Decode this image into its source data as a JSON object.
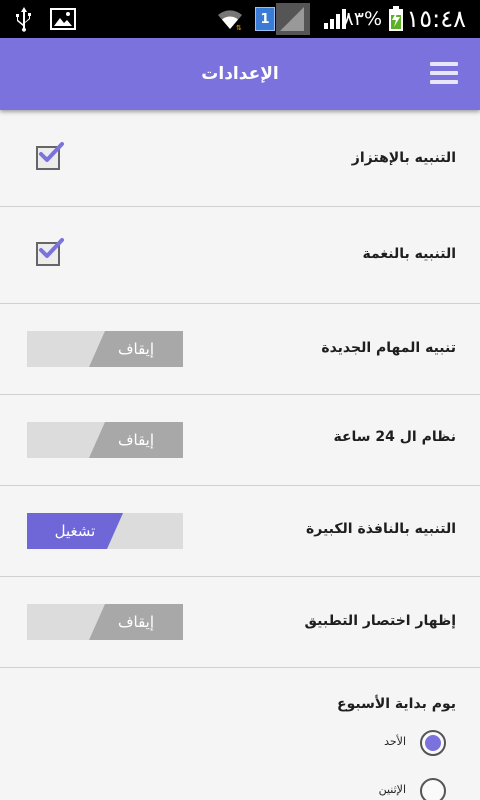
{
  "status_bar": {
    "time": "١٥:٤٨",
    "battery_percent": "٨٣%",
    "sim_badge": "1",
    "icons": [
      "usb-icon",
      "picture-icon",
      "wifi-icon",
      "sim-icon",
      "signal-icon",
      "battery-charging-icon"
    ]
  },
  "action_bar": {
    "title": "الإعدادات",
    "menu_icon": "hamburger-menu-icon",
    "color": "#7b72dd"
  },
  "settings": {
    "vibrate": {
      "label": "التنبيه بالإهتزاز",
      "checked": true
    },
    "sound": {
      "label": "التنبيه بالنغمة",
      "checked": true
    },
    "new_tasks": {
      "label": "تنبيه المهام الجديدة",
      "state": "إيقاف"
    },
    "clock24": {
      "label": "نظام ال 24 ساعة",
      "state": "إيقاف"
    },
    "big_window": {
      "label": "التنبيه بالنافذة الكبيرة",
      "state": "تشغيل"
    },
    "shortcut": {
      "label": "إظهار اختصار التطبيق",
      "state": "إيقاف"
    },
    "week_start": {
      "label": "يوم بداية الأسبوع",
      "options": [
        {
          "label": "الأحد",
          "checked": true
        },
        {
          "label": "الإثنين",
          "checked": false
        }
      ]
    }
  },
  "colors": {
    "accent": "#7b72dd",
    "toggle_on": "#6f67d8",
    "toggle_off_knob": "#a8a8a8",
    "toggle_track": "#dcdcdc"
  }
}
